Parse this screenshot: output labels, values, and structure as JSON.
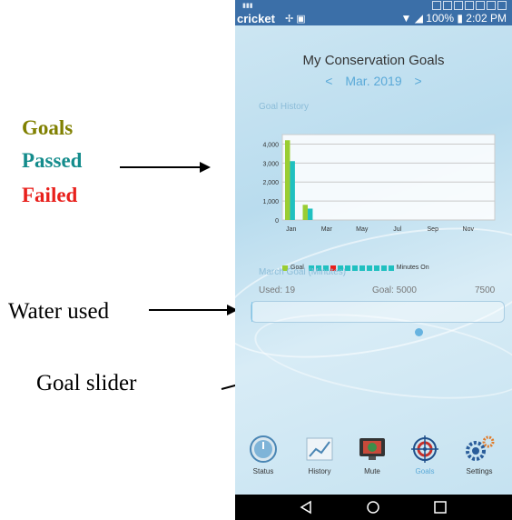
{
  "annotations": {
    "legend": [
      {
        "label": "Goals",
        "color": "#808000"
      },
      {
        "label": "Passed",
        "color": "#148c8c"
      },
      {
        "label": "Failed",
        "color": "#e8201c"
      }
    ],
    "water_used": "Water used",
    "goal_slider": "Goal slider"
  },
  "phone": {
    "status": {
      "carrier": "cricket",
      "battery": "100%",
      "time": "2:02 PM"
    },
    "title": "My Conservation Goals",
    "month": {
      "prev": "<",
      "label": "Mar. 2019",
      "next": ">"
    },
    "history_label": "Goal History",
    "goal_label": "March Goal (Minutes)",
    "used": "Used: 19",
    "goal": "Goal: 5000",
    "max": "7500",
    "slider_fraction": 0.667,
    "usage_fraction": 0.0025,
    "nav": [
      {
        "label": "Status",
        "icon": "clock-icon"
      },
      {
        "label": "History",
        "icon": "chart-icon"
      },
      {
        "label": "Mute",
        "icon": "monitor-icon"
      },
      {
        "label": "Goals",
        "icon": "target-icon",
        "active": true
      },
      {
        "label": "Settings",
        "icon": "gears-icon"
      }
    ]
  },
  "chart_data": {
    "type": "bar",
    "title": "Goal History",
    "categories": [
      "Jan",
      "Feb",
      "Mar",
      "Apr",
      "May",
      "Jun",
      "Jul",
      "Aug",
      "Sep",
      "Oct",
      "Nov",
      "Dec"
    ],
    "x_tick_labels": [
      "Jan",
      "Mar",
      "May",
      "Jul",
      "Sep",
      "Nov"
    ],
    "series": [
      {
        "name": "Goal",
        "color": "#9acd32",
        "values": [
          4200,
          800,
          null,
          null,
          null,
          null,
          null,
          null,
          null,
          null,
          null,
          null
        ]
      },
      {
        "name": "Minutes On",
        "color": "#20c0c0",
        "values": [
          3100,
          600,
          null,
          null,
          null,
          null,
          null,
          null,
          null,
          null,
          null,
          null
        ]
      }
    ],
    "legend_colors": [
      "#9acd32",
      "#20c0c0",
      "#20c0c0",
      "#20c0c0",
      "#e8201c",
      "#20c0c0",
      "#20c0c0",
      "#20c0c0",
      "#20c0c0",
      "#20c0c0",
      "#20c0c0",
      "#20c0c0",
      "#20c0c0"
    ],
    "y_ticks": [
      "4,000",
      "3,000",
      "2,000",
      "1,000",
      "0"
    ],
    "y_tick_values": [
      4000,
      3000,
      2000,
      1000,
      0
    ],
    "ylim": [
      0,
      4500
    ],
    "grid": true,
    "legend": "bottom"
  }
}
